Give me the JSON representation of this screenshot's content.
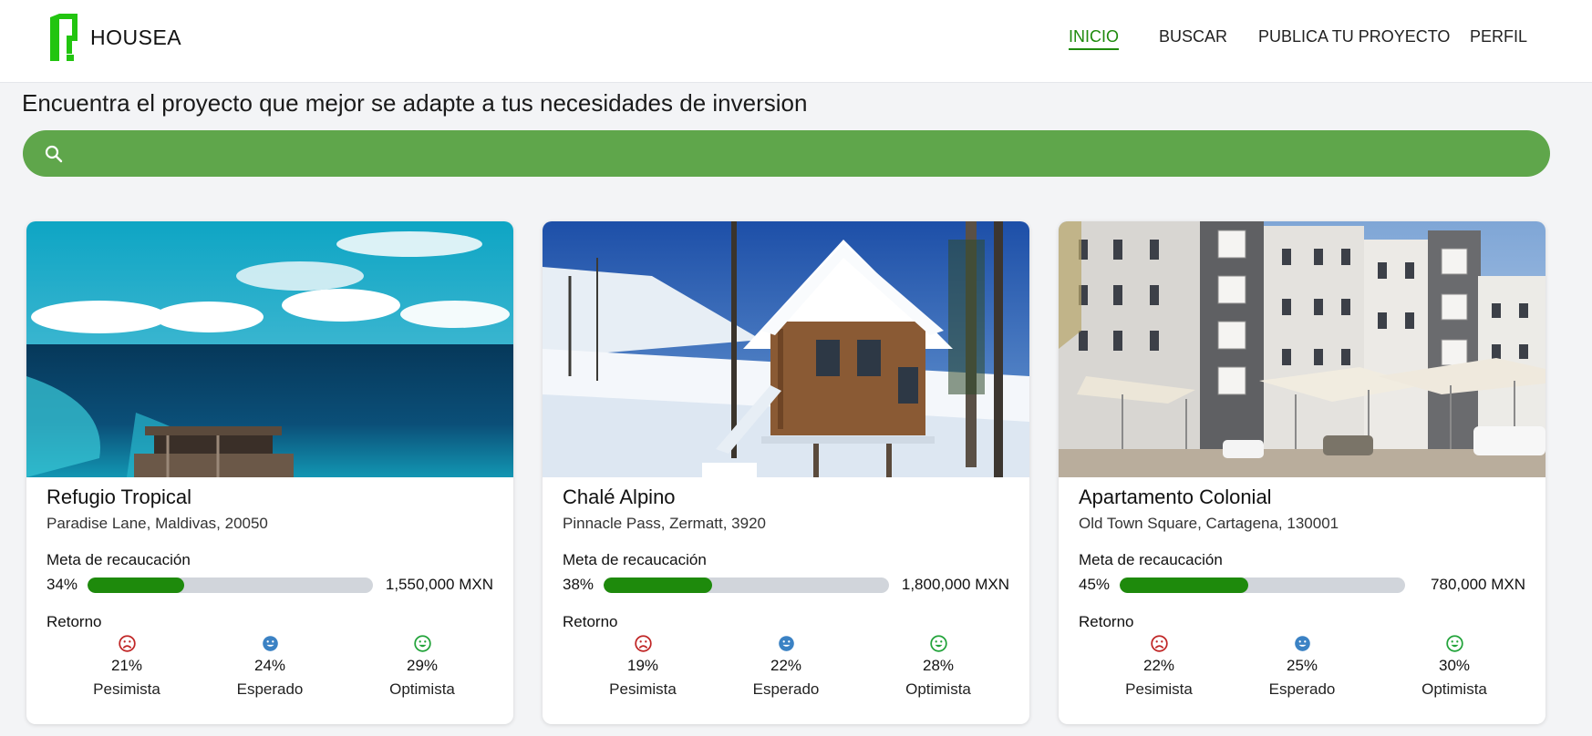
{
  "app": {
    "name": "HOUSEA"
  },
  "nav": {
    "items": [
      "INICIO",
      "BUSCAR",
      "PUBLICA TU PROYECTO",
      "PERFIL"
    ],
    "active": "INICIO"
  },
  "headline": "Encuentra el proyecto que mejor se adapte a tus necesidades de inversion",
  "search": {
    "placeholder": "",
    "value": ""
  },
  "labels": {
    "goal": "Meta de recaucación",
    "return": "Retorno",
    "pessimist": "Pesimista",
    "expected": "Esperado",
    "optimist": "Optimista"
  },
  "colors": {
    "brand": "#1e8a0c",
    "search_bg": "#5fa64b",
    "pessimist": "#c02626",
    "expected": "#3b82c4",
    "optimist": "#22a33a"
  },
  "icons": {
    "search": "search-icon",
    "pessimist": "sad-face-icon",
    "expected": "neutral-face-icon",
    "optimist": "happy-face-icon"
  },
  "projects": [
    {
      "title": "Refugio Tropical",
      "address": "Paradise Lane, Maldivas, 20050",
      "progress": "34%",
      "progress_value": 34,
      "goal_amount": "1,550,000 MXN",
      "returns": {
        "pessimist": "21%",
        "expected": "24%",
        "optimist": "29%"
      },
      "image": "tropical ocean villa photo"
    },
    {
      "title": "Chalé Alpino",
      "address": "Pinnacle Pass, Zermatt, 3920",
      "progress": "38%",
      "progress_value": 38,
      "goal_amount": "1,800,000 MXN",
      "returns": {
        "pessimist": "19%",
        "expected": "22%",
        "optimist": "28%"
      },
      "image": "snowy wooden chalet photo"
    },
    {
      "title": "Apartamento Colonial",
      "address": "Old Town Square, Cartagena, 130001",
      "progress": "45%",
      "progress_value": 45,
      "goal_amount": "780,000 MXN",
      "returns": {
        "pessimist": "22%",
        "expected": "25%",
        "optimist": "30%"
      },
      "image": "apartment building with shade canopies photo"
    }
  ]
}
